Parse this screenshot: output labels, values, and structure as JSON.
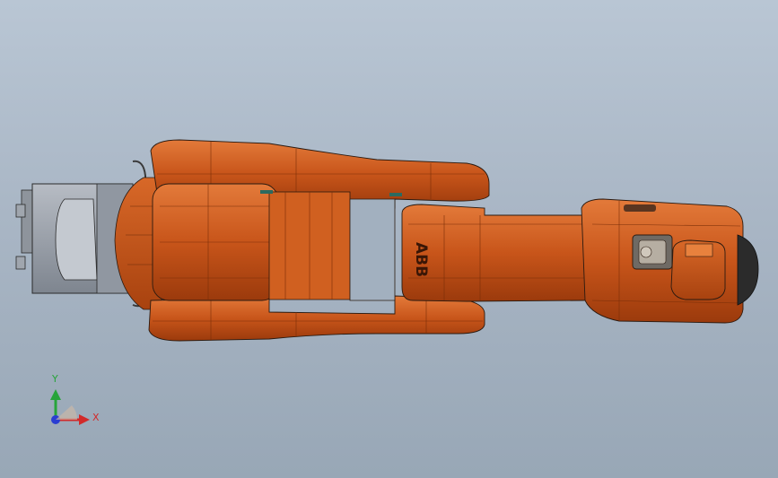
{
  "scene": {
    "background_top": "#b9c6d4",
    "background_bottom": "#98a7b6",
    "model_color": "#c8551a",
    "model_dark": "#8c3208",
    "model_light": "#e0722c",
    "base_color": "#9aa1ab",
    "edge_color": "#2a1a10"
  },
  "model": {
    "brand_logo": "ABB"
  },
  "triad": {
    "x_label": "X",
    "y_label": "Y",
    "x_color": "#d22a2a",
    "y_color": "#27a43a",
    "z_color": "#2a3ed2"
  }
}
